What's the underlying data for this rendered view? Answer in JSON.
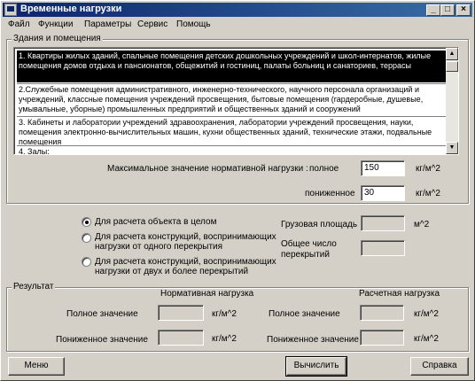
{
  "window": {
    "title": "Временные нагрузки",
    "minimize": "_",
    "maximize": "□",
    "close": "×"
  },
  "menu": [
    "Файл",
    "Функции",
    "Параметры",
    "Сервис",
    "Помощь"
  ],
  "buildings": {
    "group_label": "Здания и помещения",
    "items": [
      "1. Квартиры жилых зданий, спальные  помещения детских дошкольных учреждений и школ-интернатов, жилые помещения домов отдыха и пансионатов, общежитий и гостиниц, палаты больниц и санаториев, террасы",
      "2.Служебные помещения административного, инженерно-технического, научного персонала организаций и учреждений, классные помещения учреждений просвещения, бытовые помещения (гардеробные, душевые, умывальные, уборные) промышленных предприятий и общественных зданий и сооружений",
      "3. Кабинеты и лаборатории учреждений здравоохранения, лаборатории учреждений просвещения, науки, помещения электронно-вычислительных машин, кухни общественных зданий, технические этажи, подвальные помещения",
      "4. Залы:"
    ],
    "selected_index": 0,
    "scroll_up": "▲",
    "scroll_down": "▼"
  },
  "normative": {
    "max_label": "Максимальное значение нормативной нагрузки :",
    "full_label": "полное",
    "full_value": "150",
    "full_unit": "кг/м^2",
    "reduced_label": "пониженное",
    "reduced_value": "30",
    "reduced_unit": "кг/м^2"
  },
  "calc_options": {
    "opt1": "Для расчета объекта в целом",
    "opt2": "Для расчета конструкций, воспринимающих нагрузки от одного перекрытия",
    "opt3": "Для расчета конструкций, воспринимающих нагрузки от двух и более перекрытий",
    "selected": 1,
    "cargo_area_label": "Грузовая площадь",
    "cargo_area_value": "",
    "cargo_area_unit": "м^2",
    "floors_label": "Общее число перекрытий",
    "floors_value": ""
  },
  "result": {
    "group_label": "Результат",
    "normative_header": "Нормативная нагрузка",
    "calc_header": "Расчетная нагрузка",
    "full_label": "Полное значение",
    "reduced_label": "Пониженное значение",
    "unit": "кг/м^2",
    "norm_full": "",
    "norm_reduced": "",
    "calc_full": "",
    "calc_reduced": ""
  },
  "buttons": {
    "menu": "Меню",
    "calculate": "Вычислить",
    "help": "Справка"
  }
}
